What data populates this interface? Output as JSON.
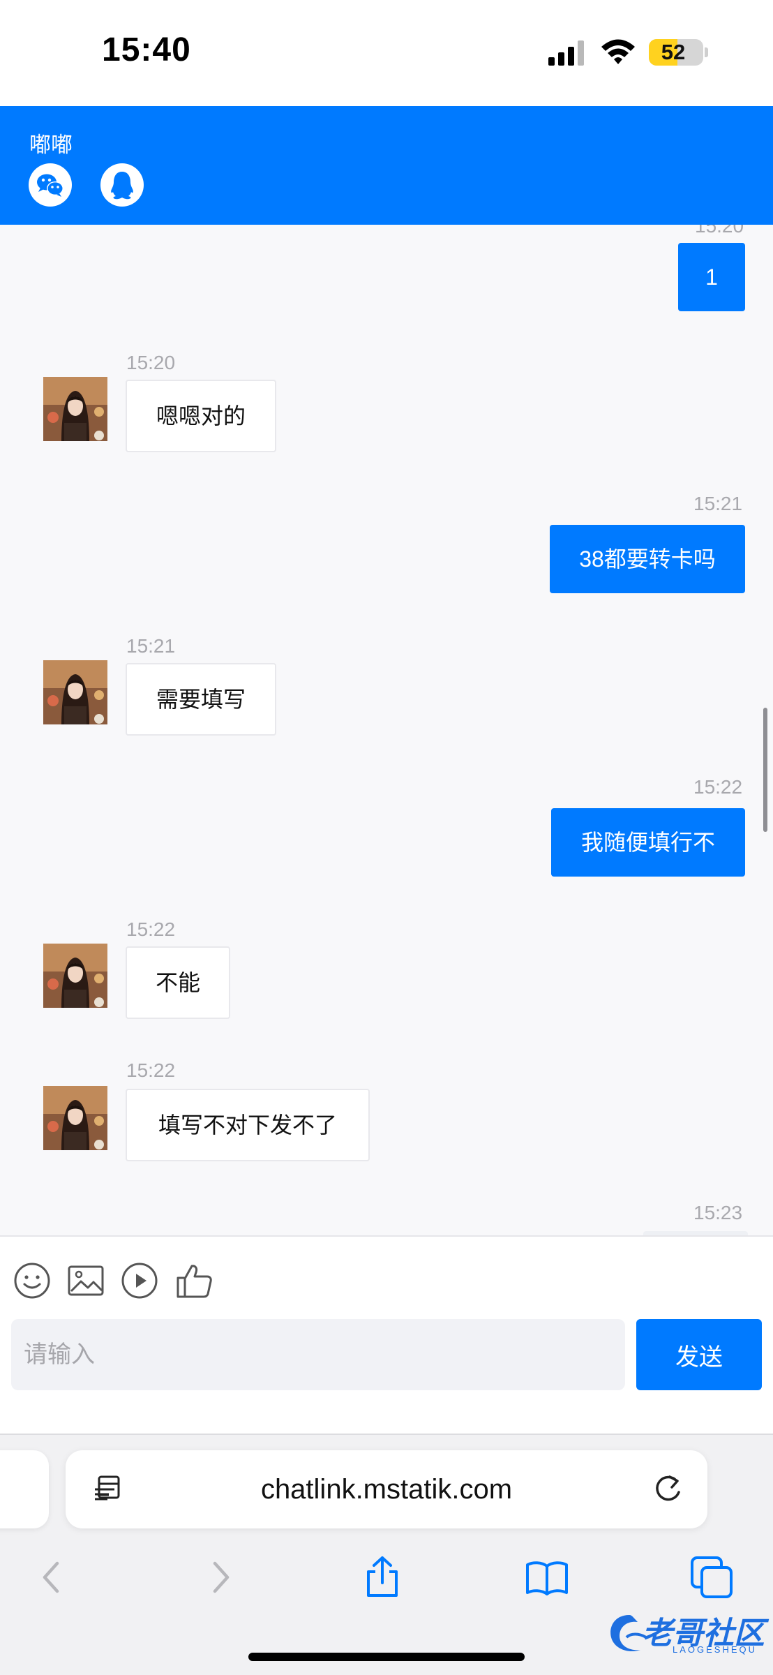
{
  "status_bar": {
    "time": "15:40",
    "battery_level": 52,
    "battery_color": "#ffd21f"
  },
  "header": {
    "title": "嘟嘟",
    "icons": [
      "wechat-icon",
      "qq-icon"
    ],
    "background": "#007aff"
  },
  "messages": [
    {
      "direction": "outgoing",
      "time": "15:20",
      "text": "1"
    },
    {
      "direction": "incoming",
      "time": "15:20",
      "text": "嗯嗯对的"
    },
    {
      "direction": "outgoing",
      "time": "15:21",
      "text": "38都要转卡吗"
    },
    {
      "direction": "incoming",
      "time": "15:21",
      "text": "需要填写"
    },
    {
      "direction": "outgoing",
      "time": "15:22",
      "text": "我随便填行不"
    },
    {
      "direction": "incoming",
      "time": "15:22",
      "text": "不能"
    },
    {
      "direction": "incoming",
      "time": "15:22",
      "text": "填写不对下发不了"
    },
    {
      "direction": "outgoing",
      "time": "15:23",
      "text": ""
    }
  ],
  "toolbar": {
    "icons": [
      "emoji-icon",
      "image-icon",
      "video-icon",
      "thumbs-up-icon"
    ]
  },
  "composer": {
    "placeholder": "请输入",
    "value": "",
    "send_label": "发送"
  },
  "browser": {
    "url": "chatlink.mstatik.com",
    "nav_icons": [
      "back-icon",
      "forward-icon",
      "share-icon",
      "bookmarks-icon",
      "tabs-icon"
    ]
  },
  "watermark": {
    "text": "老哥社区",
    "subtext": "LAOGESHEQU"
  }
}
